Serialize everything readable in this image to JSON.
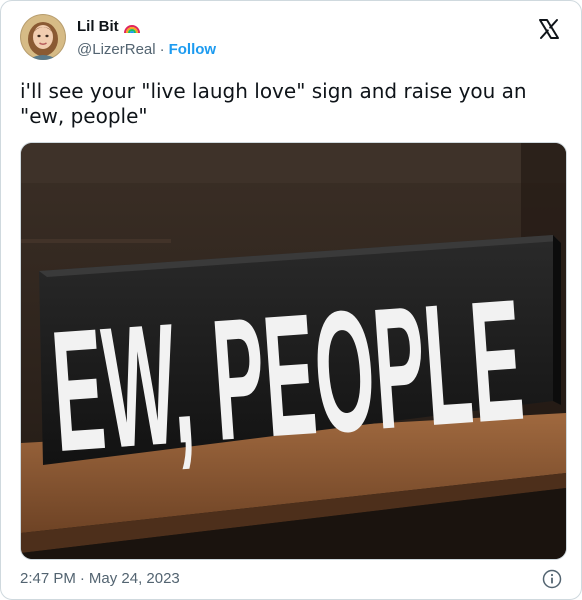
{
  "author": {
    "display_name": "Lil Bit",
    "handle": "@LizerReal",
    "separator": "·",
    "follow_label": "Follow"
  },
  "icons": {
    "badge": "rainbow-icon",
    "platform": "x-logo-icon",
    "info": "info-icon"
  },
  "tweet": {
    "text": "i'll see your \"live laugh love\" sign and raise you an \"ew, people\""
  },
  "media": {
    "sign_text": "EW, PEOPLE"
  },
  "meta": {
    "time": "2:47 PM",
    "separator": "·",
    "date": "May 24, 2023"
  },
  "colors": {
    "accent": "#1d9bf0",
    "secondary_text": "#536471",
    "primary_text": "#0f1419",
    "border": "#cfd9de"
  }
}
